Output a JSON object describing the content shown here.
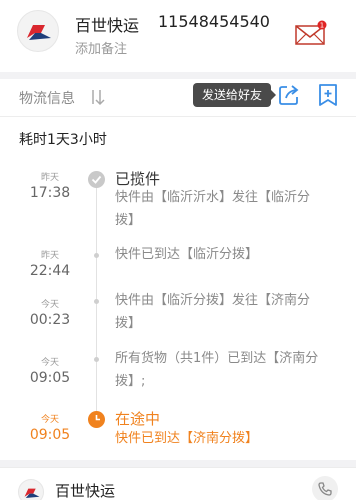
{
  "header": {
    "courier_name": "百世快运",
    "tracking_number": "11548454540",
    "add_note": "添加备注",
    "mail_badge": "1"
  },
  "tabs": {
    "logistics_label": "物流信息",
    "tooltip": "发送给好友"
  },
  "summary": {
    "duration": "耗时1天3小时"
  },
  "timeline": [
    {
      "day": "昨天",
      "time": "17:38",
      "status": "已揽件",
      "desc_line1": "快件由【临沂沂水】发往【临沂分",
      "desc_line2": "拨】"
    },
    {
      "day": "昨天",
      "time": "22:44",
      "status": "",
      "desc_line1": "快件已到达【临沂分拨】",
      "desc_line2": ""
    },
    {
      "day": "今天",
      "time": "00:23",
      "status": "",
      "desc_line1": "快件由【临沂分拨】发往【济南分",
      "desc_line2": "拨】"
    },
    {
      "day": "今天",
      "time": "09:05",
      "status": "",
      "desc_line1": " 所有货物（共1件）已到达【济南分",
      "desc_line2": "拨】;"
    },
    {
      "day": "今天",
      "time": "09:05",
      "status": "在途中",
      "desc_line1": "快件已到达【济南分拨】",
      "desc_line2": ""
    }
  ],
  "footer": {
    "courier_name": "百世快运"
  },
  "colors": {
    "accent": "#f0821e",
    "icon_blue": "#3a8ee6",
    "brand_red": "#d9272e",
    "brand_navy": "#1f3e7a"
  }
}
